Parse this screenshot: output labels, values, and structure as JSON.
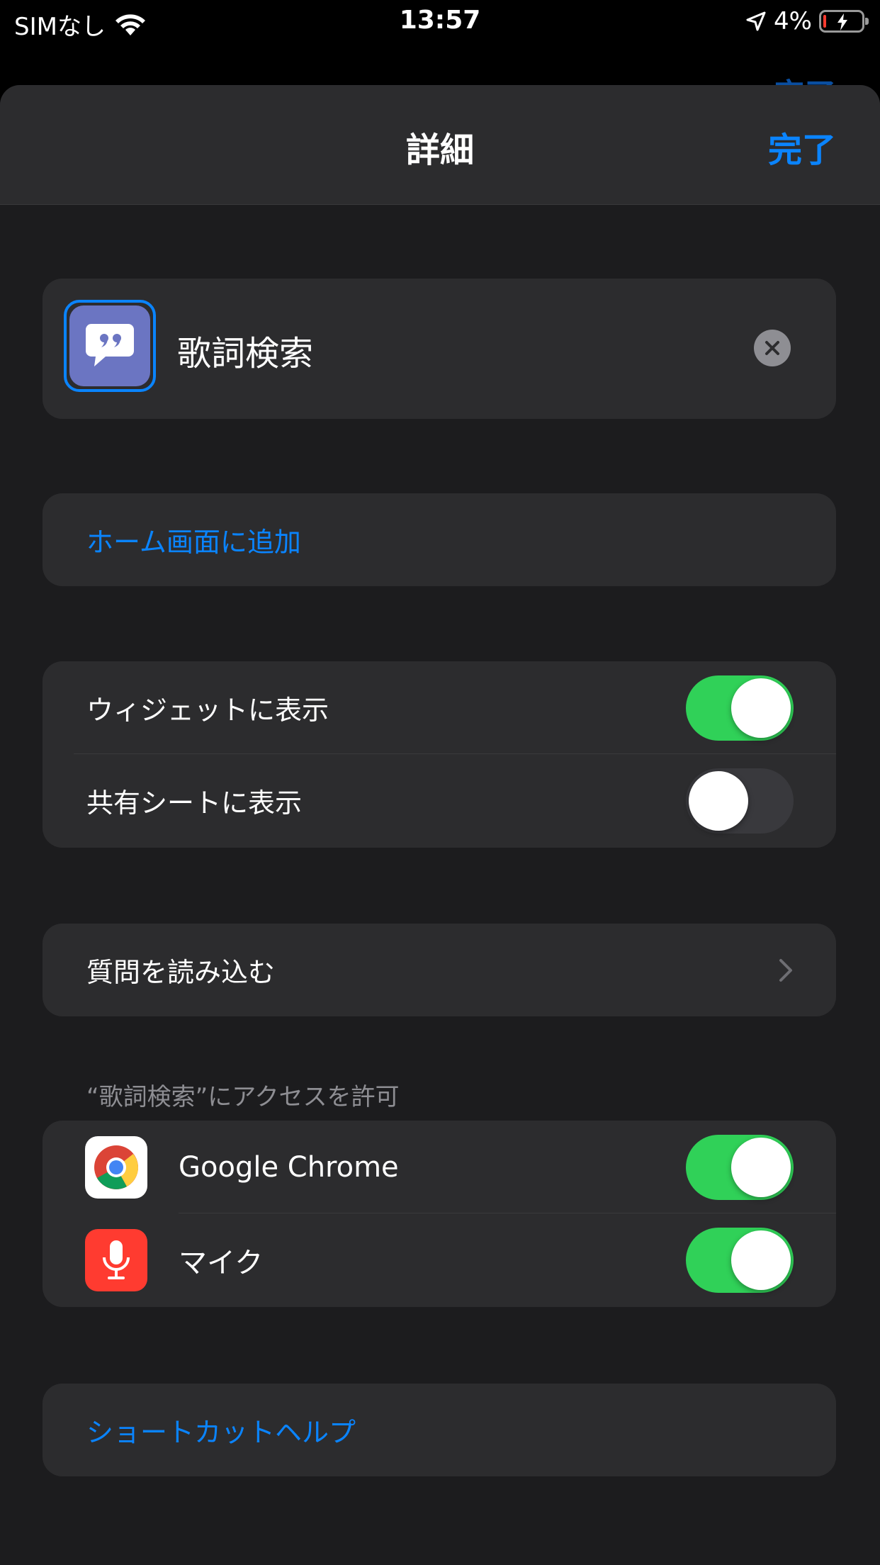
{
  "status_bar": {
    "carrier": "SIMなし",
    "time": "13:57",
    "battery": "4%"
  },
  "background_sheet": {
    "done_label": "完了"
  },
  "nav": {
    "title": "詳細",
    "done_label": "完了"
  },
  "shortcut": {
    "name": "歌詞検索",
    "icon": "quote-bubble-icon",
    "icon_color": "#6b75c2"
  },
  "actions": {
    "add_to_home": "ホーム画面に追加"
  },
  "toggles": [
    {
      "label": "ウィジェットに表示",
      "on": true
    },
    {
      "label": "共有シートに表示",
      "on": false
    }
  ],
  "import_questions": {
    "label": "質問を読み込む"
  },
  "access": {
    "header": "“歌詞検索”にアクセスを許可",
    "apps": [
      {
        "name": "Google Chrome",
        "icon": "chrome-icon",
        "on": true
      },
      {
        "name": "マイク",
        "icon": "microphone-icon",
        "on": true
      }
    ]
  },
  "help": {
    "label": "ショートカットヘルプ"
  },
  "colors": {
    "accent": "#0a84ff",
    "toggle_on": "#30d158",
    "mic_red": "#ff3b30"
  }
}
